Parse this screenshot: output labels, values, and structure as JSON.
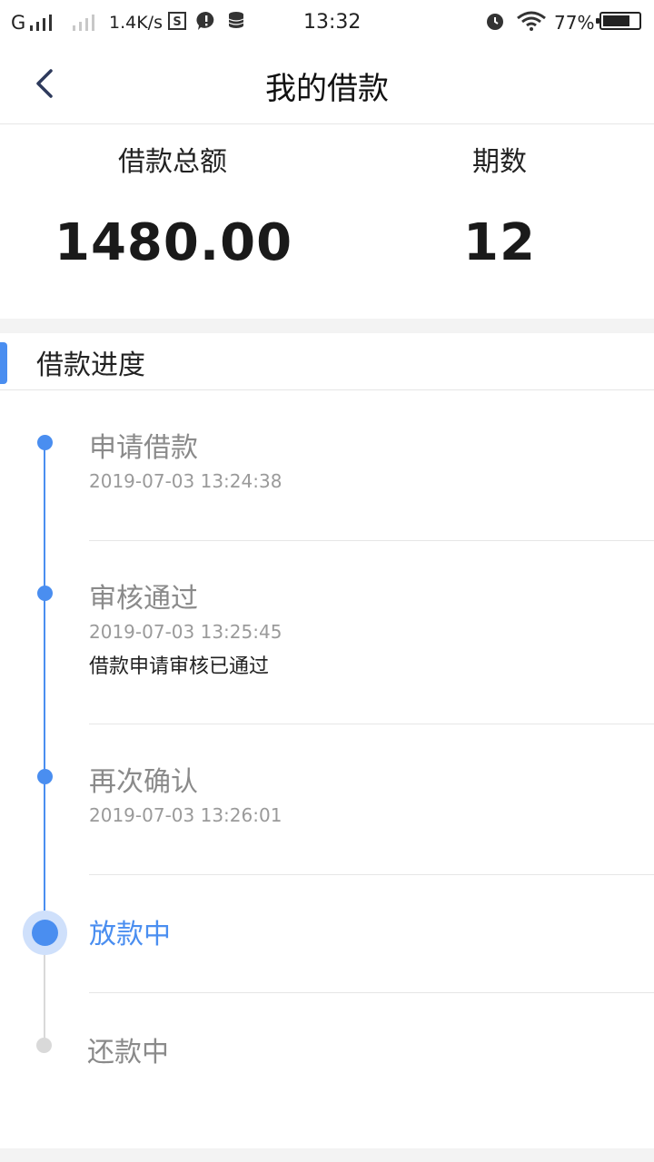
{
  "status_bar": {
    "carrier": "G",
    "speed": "1.4K/s",
    "time": "13:32",
    "battery": "77%"
  },
  "nav": {
    "title": "我的借款",
    "back_icon": "chevron-left-icon"
  },
  "summary": {
    "total_label": "借款总额",
    "total_value": "1480.00",
    "periods_label": "期数",
    "periods_value": "12"
  },
  "progress": {
    "title": "借款进度",
    "steps": [
      {
        "title": "申请借款",
        "time": "2019-07-03 13:24:38",
        "desc": "",
        "state": "done"
      },
      {
        "title": "审核通过",
        "time": "2019-07-03 13:25:45",
        "desc": "借款申请审核已通过",
        "state": "done"
      },
      {
        "title": "再次确认",
        "time": "2019-07-03 13:26:01",
        "desc": "",
        "state": "done"
      },
      {
        "title": "放款中",
        "time": "",
        "desc": "",
        "state": "current"
      },
      {
        "title": "还款中",
        "time": "",
        "desc": "",
        "state": "pending"
      }
    ]
  },
  "colors": {
    "accent": "#4a8ef0",
    "pending": "#d9d9d9",
    "muted_text": "#8a8a8a"
  }
}
